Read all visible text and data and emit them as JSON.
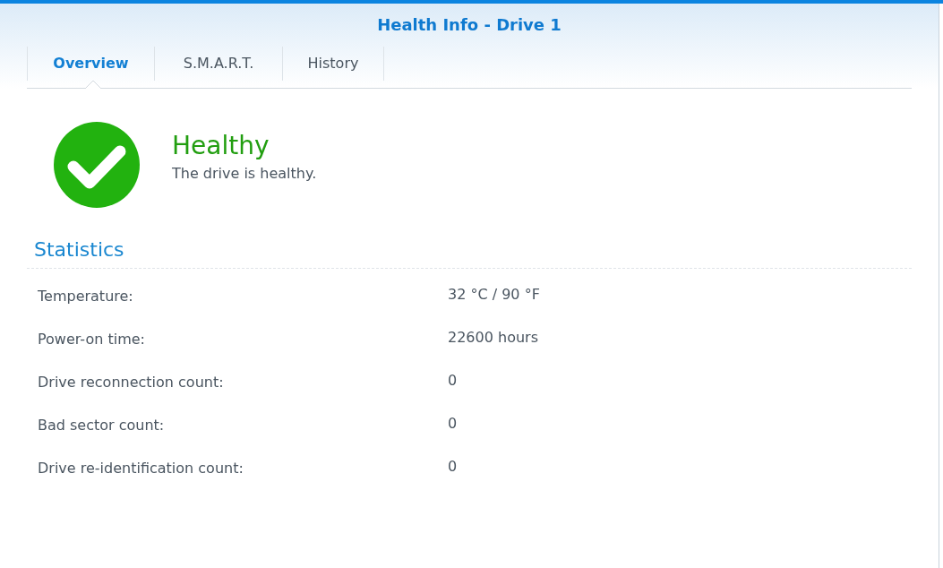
{
  "window": {
    "title": "Health Info - Drive 1"
  },
  "tabs": [
    {
      "label": "Overview",
      "selected": true
    },
    {
      "label": "S.M.A.R.T.",
      "selected": false
    },
    {
      "label": "History",
      "selected": false
    }
  ],
  "status": {
    "kind": "healthy",
    "title": "Healthy",
    "message": "The drive is healthy."
  },
  "statistics": {
    "heading": "Statistics",
    "rows": [
      {
        "label": "Temperature:",
        "value": "32 °C / 90 °F"
      },
      {
        "label": "Power-on time:",
        "value": "22600 hours"
      },
      {
        "label": "Drive reconnection count:",
        "value": "0"
      },
      {
        "label": "Bad sector count:",
        "value": "0"
      },
      {
        "label": "Drive re-identification count:",
        "value": "0"
      }
    ]
  }
}
